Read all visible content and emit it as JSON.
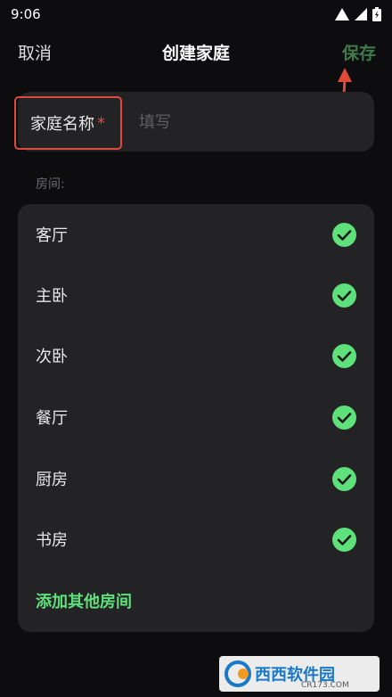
{
  "status_bar": {
    "time": "9:06"
  },
  "nav": {
    "cancel_label": "取消",
    "title": "创建家庭",
    "save_label": "保存"
  },
  "family_name": {
    "label": "家庭名称",
    "required_mark": "*",
    "placeholder": "填写",
    "value": ""
  },
  "rooms": {
    "section_label": "房间:",
    "items": [
      {
        "name": "客厅",
        "checked": true
      },
      {
        "name": "主卧",
        "checked": true
      },
      {
        "name": "次卧",
        "checked": true
      },
      {
        "name": "餐厅",
        "checked": true
      },
      {
        "name": "厨房",
        "checked": true
      },
      {
        "name": "书房",
        "checked": true
      }
    ],
    "add_label": "添加其他房间"
  },
  "watermark": {
    "text": "西西软件园",
    "sub": "CR173.COM"
  },
  "colors": {
    "accent_green": "#5ee07a",
    "save_green": "#3f7a4a",
    "annotation_red": "#e04a3a",
    "card_bg": "#232326",
    "page_bg": "#0d0d0f"
  }
}
